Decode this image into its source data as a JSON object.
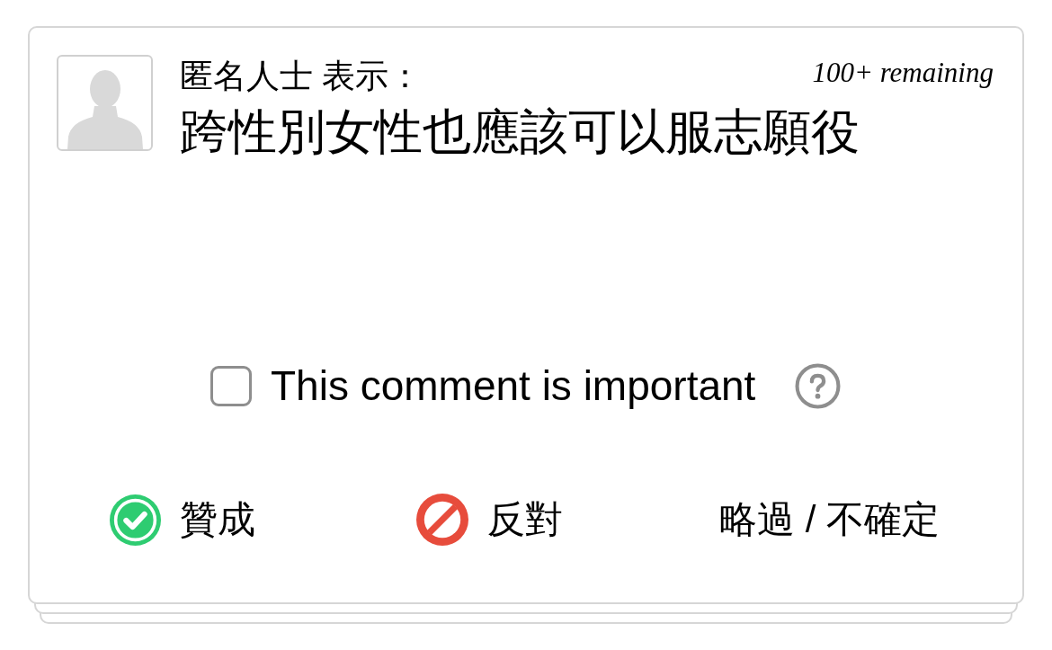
{
  "comment": {
    "author": "匿名人士 表示：",
    "remaining": "100+ remaining",
    "statement": "跨性別女性也應該可以服志願役"
  },
  "important": {
    "label": "This comment is important",
    "checked": false
  },
  "votes": [
    {
      "kind": "agree",
      "label": "贊成"
    },
    {
      "kind": "disagree",
      "label": "反對"
    },
    {
      "kind": "pass",
      "label": "略過 / 不確定"
    }
  ]
}
